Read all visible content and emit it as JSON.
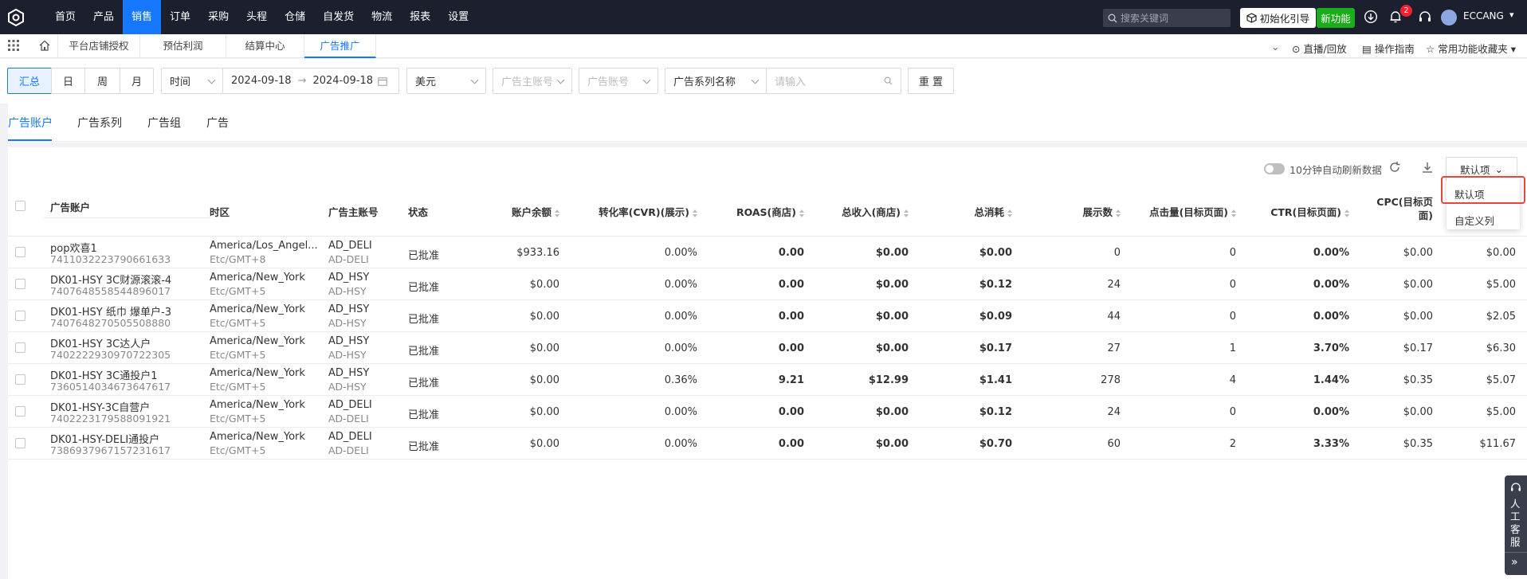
{
  "nav": {
    "items": [
      "首页",
      "产品",
      "销售",
      "订单",
      "采购",
      "头程",
      "仓储",
      "自发货",
      "物流",
      "报表",
      "设置"
    ],
    "active": "销售"
  },
  "header": {
    "search_placeholder": "搜索关键词",
    "guide_label": "初始化引导",
    "new_label": "新功能",
    "notification_count": "2",
    "username": "ECCANG"
  },
  "page_tabs": [
    "平台店铺授权",
    "预估利润",
    "结算中心",
    "广告推广"
  ],
  "right_links": {
    "live": "直播/回放",
    "guide": "操作指南",
    "favorites": "常用功能收藏夹"
  },
  "filters": {
    "segments": [
      "汇总",
      "日",
      "周",
      "月"
    ],
    "time_type": "时间",
    "start_date": "2024-09-18",
    "end_date": "2024-09-18",
    "currency": "美元",
    "main_account_placeholder": "广告主账号",
    "account_placeholder": "广告账号",
    "series_select": "广告系列名称",
    "search_placeholder": "请输入",
    "reset": "重 置"
  },
  "subtabs": [
    "广告账户",
    "广告系列",
    "广告组",
    "广告"
  ],
  "toolbar": {
    "auto_refresh": "10分钟自动刷新数据",
    "view_select": "默认项"
  },
  "dropdown": {
    "items": [
      "默认项",
      "自定义列"
    ]
  },
  "table": {
    "headers": {
      "account": "广告账户",
      "timezone": "时区",
      "main_account": "广告主账号",
      "status": "状态",
      "balance": "账户余额",
      "cvr": "转化率(CVR)(展示)",
      "roas": "ROAS(商店)",
      "revenue": "总收入(商店)",
      "spend": "总消耗",
      "impressions": "展示数",
      "clicks": "点击量(目标页面)",
      "ctr": "CTR(目标页面)",
      "cpc_line1": "CPC(目标页",
      "cpc_line2": "面)"
    },
    "rows": [
      {
        "name": "pop欢喜1",
        "id": "7411032223790661633",
        "tz": "America/Los_Angel...",
        "tz2": "Etc/GMT+8",
        "acct": "AD_DELI",
        "acct2": "AD-DELI",
        "status": "已批准",
        "balance": "$933.16",
        "cvr": "0.00%",
        "roas": "0.00",
        "revenue": "$0.00",
        "spend": "$0.00",
        "impr": "0",
        "clicks": "0",
        "ctr": "0.00%",
        "cpc": "$0.00",
        "extra": "$0.00"
      },
      {
        "name": "DK01-HSY 3C财源滚滚-4",
        "id": "7407648558544896017",
        "tz": "America/New_York",
        "tz2": "Etc/GMT+5",
        "acct": "AD_HSY",
        "acct2": "AD-HSY",
        "status": "已批准",
        "balance": "$0.00",
        "cvr": "0.00%",
        "roas": "0.00",
        "revenue": "$0.00",
        "spend": "$0.12",
        "impr": "24",
        "clicks": "0",
        "ctr": "0.00%",
        "cpc": "$0.00",
        "extra": "$5.00"
      },
      {
        "name": "DK01-HSY 纸巾 爆单户-3",
        "id": "7407648270505508880",
        "tz": "America/New_York",
        "tz2": "Etc/GMT+5",
        "acct": "AD_HSY",
        "acct2": "AD-HSY",
        "status": "已批准",
        "balance": "$0.00",
        "cvr": "0.00%",
        "roas": "0.00",
        "revenue": "$0.00",
        "spend": "$0.09",
        "impr": "44",
        "clicks": "0",
        "ctr": "0.00%",
        "cpc": "$0.00",
        "extra": "$2.05"
      },
      {
        "name": "DK01-HSY 3C达人户",
        "id": "7402222930970722305",
        "tz": "America/New_York",
        "tz2": "Etc/GMT+5",
        "acct": "AD_HSY",
        "acct2": "AD-HSY",
        "status": "已批准",
        "balance": "$0.00",
        "cvr": "0.00%",
        "roas": "0.00",
        "revenue": "$0.00",
        "spend": "$0.17",
        "impr": "27",
        "clicks": "1",
        "ctr": "3.70%",
        "cpc": "$0.17",
        "extra": "$6.30"
      },
      {
        "name": "DK01-HSY 3C通投户1",
        "id": "7360514034673647617",
        "tz": "America/New_York",
        "tz2": "Etc/GMT+5",
        "acct": "AD_HSY",
        "acct2": "AD-HSY",
        "status": "已批准",
        "balance": "$0.00",
        "cvr": "0.36%",
        "roas": "9.21",
        "revenue": "$12.99",
        "spend": "$1.41",
        "impr": "278",
        "clicks": "4",
        "ctr": "1.44%",
        "cpc": "$0.35",
        "extra": "$5.07"
      },
      {
        "name": "DK01-HSY-3C自营户",
        "id": "7402223179588091921",
        "tz": "America/New_York",
        "tz2": "Etc/GMT+5",
        "acct": "AD_DELI",
        "acct2": "AD-DELI",
        "status": "已批准",
        "balance": "$0.00",
        "cvr": "0.00%",
        "roas": "0.00",
        "revenue": "$0.00",
        "spend": "$0.12",
        "impr": "24",
        "clicks": "0",
        "ctr": "0.00%",
        "cpc": "$0.00",
        "extra": "$5.00"
      },
      {
        "name": "DK01-HSY-DELI通投户",
        "id": "7386937967157231617",
        "tz": "America/New_York",
        "tz2": "Etc/GMT+5",
        "acct": "AD_DELI",
        "acct2": "AD-DELI",
        "status": "已批准",
        "balance": "$0.00",
        "cvr": "0.00%",
        "roas": "0.00",
        "revenue": "$0.00",
        "spend": "$0.70",
        "impr": "60",
        "clicks": "2",
        "ctr": "3.33%",
        "cpc": "$0.35",
        "extra": "$11.67"
      }
    ]
  },
  "customer_service": "人工客服",
  "colors": {
    "accent": "#1677ff",
    "topbar": "#1b1f2e",
    "success": "#1aad19",
    "highlight": "#e8453c"
  }
}
